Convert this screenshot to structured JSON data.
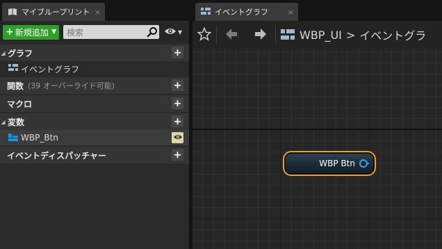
{
  "left_tab": {
    "label": "マイブループリント",
    "close": "×",
    "icon": "blueprint-book-icon"
  },
  "right_tab": {
    "label": "イベントグラフ",
    "close": "×",
    "icon": "graph-icon"
  },
  "toolbar": {
    "add_new_label": "新規追加",
    "search_placeholder": "検索"
  },
  "sections": {
    "graphs": {
      "title": "グラフ",
      "items": [
        {
          "label": "イベントグラフ",
          "icon": "graph-icon"
        }
      ]
    },
    "functions": {
      "title": "関数",
      "override_note": "(39 オーバーライド可能)"
    },
    "macros": {
      "title": "マクロ"
    },
    "variables": {
      "title": "変数",
      "items": [
        {
          "label": "WBP_Btn",
          "icon": "variable-icon"
        }
      ]
    },
    "dispatchers": {
      "title": "イベントディスパッチャー"
    }
  },
  "graph_toolbar": {
    "breadcrumb": [
      "WBP_UI",
      "イベントグラ"
    ],
    "separator": ">"
  },
  "node": {
    "label": "WBP Btn"
  },
  "colors": {
    "accent_green": "#2f9e2a",
    "node_border": "#f0a020",
    "pin_blue": "#3aa0e8",
    "variable_icon_blue": "#1f8fe0"
  }
}
